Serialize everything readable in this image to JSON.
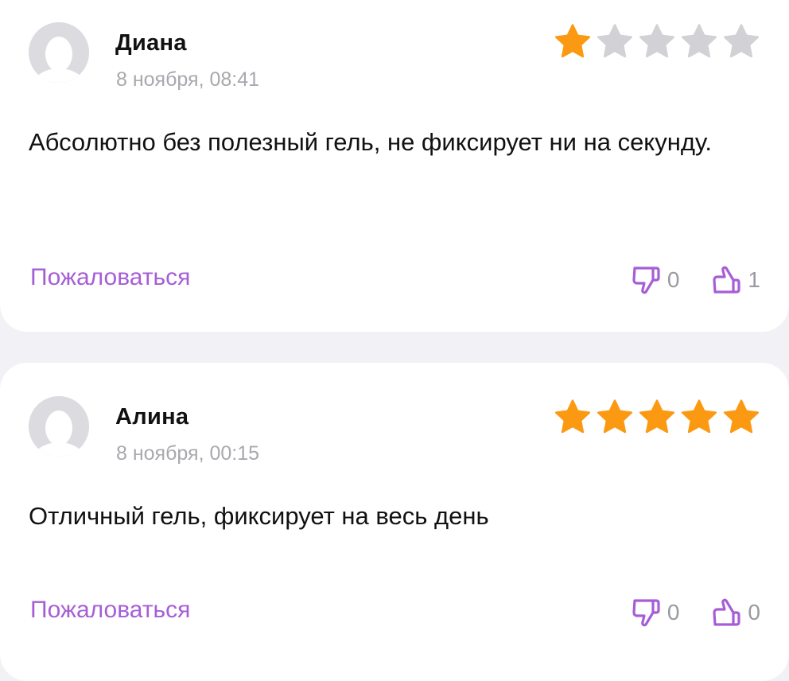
{
  "colors": {
    "accent": "#a65ed6",
    "star_filled": "#fb9a12",
    "star_empty": "#d1d1d6",
    "muted_text": "#a8a8ae",
    "background": "#f2f2f6"
  },
  "reviews": [
    {
      "author": "Диана",
      "date": "8 ноября, 08:41",
      "rating": 1,
      "max_rating": 5,
      "text": "Абсолютно без полезный гель, не фиксирует ни на секунду.",
      "complain_label": "Пожаловаться",
      "dislikes": "0",
      "likes": "1",
      "icons": {
        "avatar": "user-avatar-icon",
        "dislike": "thumbs-down-icon",
        "like": "thumbs-up-icon",
        "star": "star-icon"
      }
    },
    {
      "author": "Алина",
      "date": "8 ноября, 00:15",
      "rating": 5,
      "max_rating": 5,
      "text": "Отличный гель, фиксирует на весь день",
      "complain_label": "Пожаловаться",
      "dislikes": "0",
      "likes": "0",
      "icons": {
        "avatar": "user-avatar-icon",
        "dislike": "thumbs-down-icon",
        "like": "thumbs-up-icon",
        "star": "star-icon"
      }
    }
  ]
}
